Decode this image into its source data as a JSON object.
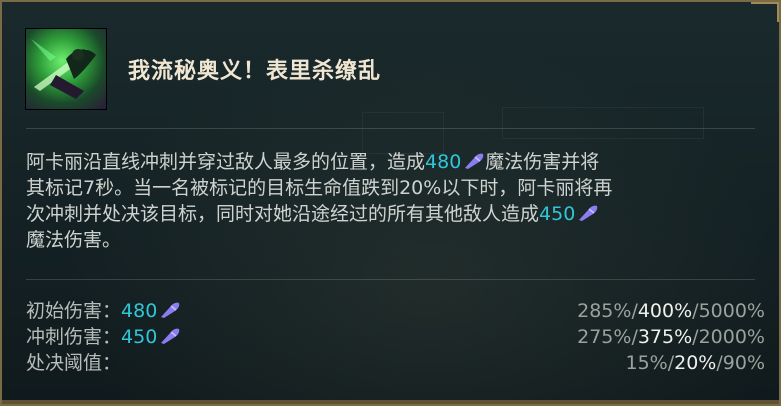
{
  "ability": {
    "title": "我流秘奥义！表里杀缭乱",
    "icon": "akali-ult-icon"
  },
  "description": {
    "line1_a": "阿卡丽沿直线冲刺并穿过敌人最多的位置，造成",
    "value1": "480",
    "line1_b": "魔法伤害并将",
    "line2": "其标记7秒。当一名被标记的目标生命值跌到20%以下时，阿卡丽将再",
    "line3_a": "次冲刺并处决该目标，同时对她沿途经过的所有其他敌人造成",
    "value2": "450",
    "line4": "魔法伤害。"
  },
  "stats": [
    {
      "label": "初始伤害：",
      "value": "480",
      "has_ap_icon": true,
      "levels": [
        "285%",
        "400%",
        "5000%"
      ],
      "sep": "/"
    },
    {
      "label": "冲刺伤害：",
      "value": "450",
      "has_ap_icon": true,
      "levels": [
        "275%",
        "375%",
        "2000%"
      ],
      "sep": "/"
    },
    {
      "label": "处决阈值：",
      "value": "",
      "has_ap_icon": false,
      "levels": [
        "15%",
        "20%",
        "90%"
      ],
      "sep": "/"
    }
  ],
  "colors": {
    "value_cyan": "#2fc7d8",
    "title": "#f0e6d2",
    "ap_icon": "#8b7cf0",
    "border_gold": "#7a6a45"
  }
}
